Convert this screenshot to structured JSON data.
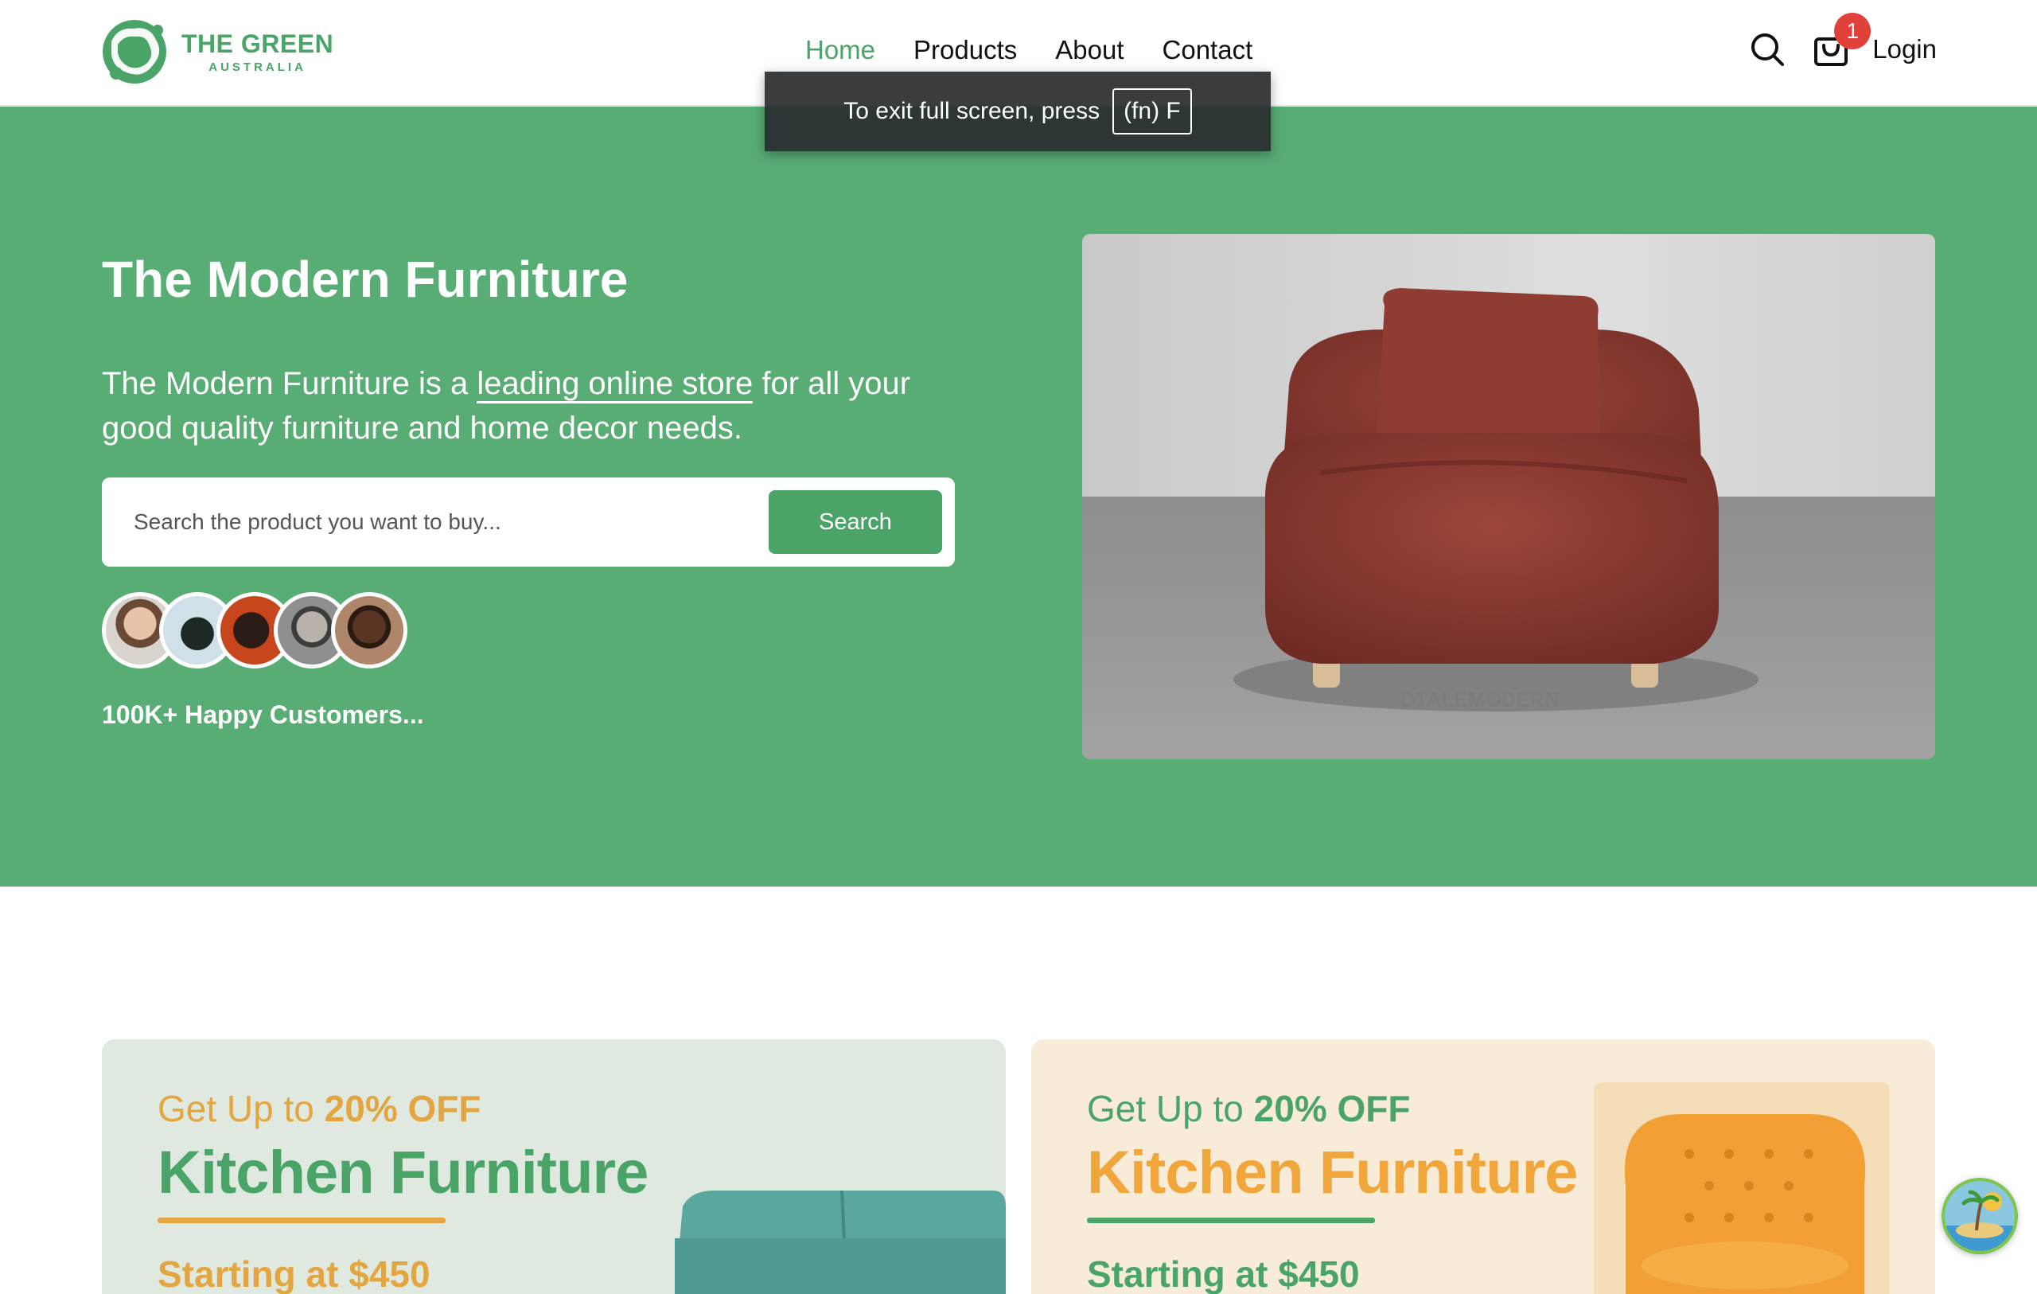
{
  "brand": {
    "name": "THE GREEN",
    "sub": "AUSTRALIA",
    "color": "#4aa468"
  },
  "nav": {
    "items": [
      {
        "label": "Home",
        "active": true
      },
      {
        "label": "Products",
        "active": false
      },
      {
        "label": "About",
        "active": false
      },
      {
        "label": "Contact",
        "active": false
      }
    ]
  },
  "header": {
    "search_icon": "search-icon",
    "cart_icon": "shopping-bag-icon",
    "cart_count": "1",
    "login_label": "Login"
  },
  "fullscreen_toast": {
    "text": "To exit full screen, press",
    "key": "(fn) F"
  },
  "hero": {
    "title": "The Modern Furniture",
    "desc_before": "The Modern Furniture is a ",
    "desc_highlight": "leading online store",
    "desc_after": " for all your good quality furniture and home decor needs.",
    "search_placeholder": "Search the product you want to buy...",
    "search_button": "Search",
    "customers": "100K+ Happy Customers...",
    "image_watermark": "DTALEMODERN",
    "background": "#57ad74"
  },
  "promos": [
    {
      "top_prefix": "Get Up to ",
      "top_off": "20% OFF",
      "title": "Kitchen Furniture",
      "starting": "Starting at $450"
    },
    {
      "top_prefix": "Get Up to ",
      "top_off": "20% OFF",
      "title": "Kitchen Furniture",
      "starting": "Starting at $450"
    }
  ]
}
